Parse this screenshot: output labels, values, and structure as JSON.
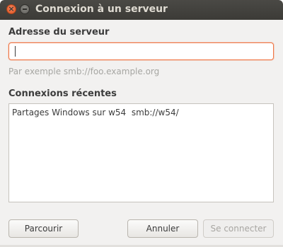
{
  "window": {
    "title": "Connexion à un serveur",
    "close_glyph": "×"
  },
  "server": {
    "label": "Adresse du serveur",
    "value": "",
    "example": "Par exemple smb://foo.example.org"
  },
  "recent": {
    "label": "Connexions récentes",
    "items": [
      {
        "name": "Partages Windows sur w54",
        "uri": "smb://w54/"
      }
    ]
  },
  "buttons": {
    "browse": "Parcourir",
    "cancel": "Annuler",
    "connect": "Se connecter"
  },
  "colors": {
    "accent": "#f07746",
    "titlebar": "#3c3b37"
  }
}
